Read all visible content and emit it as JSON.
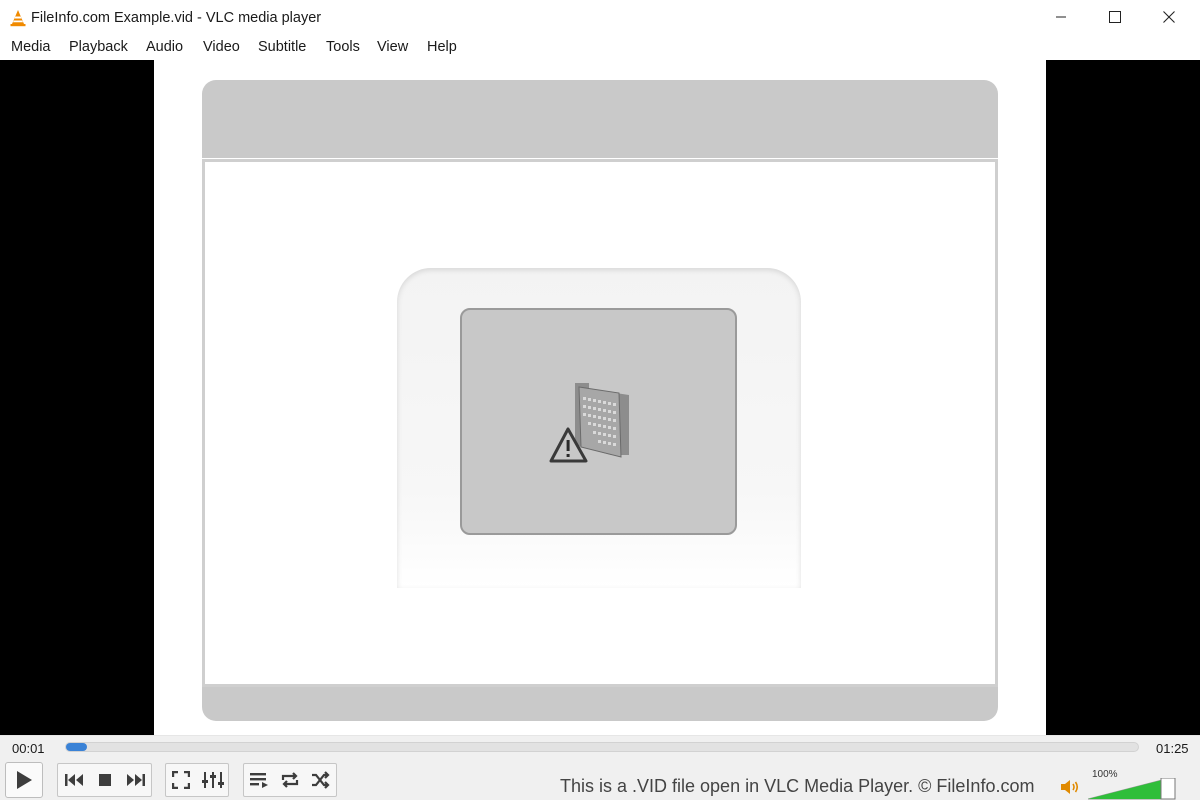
{
  "window": {
    "title": "FileInfo.com Example.vid - VLC media player"
  },
  "menu": {
    "items": [
      "Media",
      "Playback",
      "Audio",
      "Video",
      "Subtitle",
      "Tools",
      "View",
      "Help"
    ]
  },
  "playback": {
    "elapsed": "00:01",
    "total": "01:25",
    "progress_fraction": 0.02
  },
  "status": {
    "text": "This is a .VID file open in VLC Media Player. © FileInfo.com"
  },
  "volume": {
    "label": "100%",
    "level_fraction": 1.0
  },
  "colors": {
    "accent": "#3a82d6",
    "volume": "#2fbe3a",
    "vlc_orange": "#f08a00"
  },
  "icons": [
    "vlc-cone-icon",
    "minimize-icon",
    "maximize-icon",
    "close-icon",
    "play-icon",
    "previous-icon",
    "stop-icon",
    "next-icon",
    "fullscreen-icon",
    "extended-settings-icon",
    "playlist-icon",
    "loop-icon",
    "shuffle-icon",
    "speaker-icon",
    "warning-icon"
  ]
}
